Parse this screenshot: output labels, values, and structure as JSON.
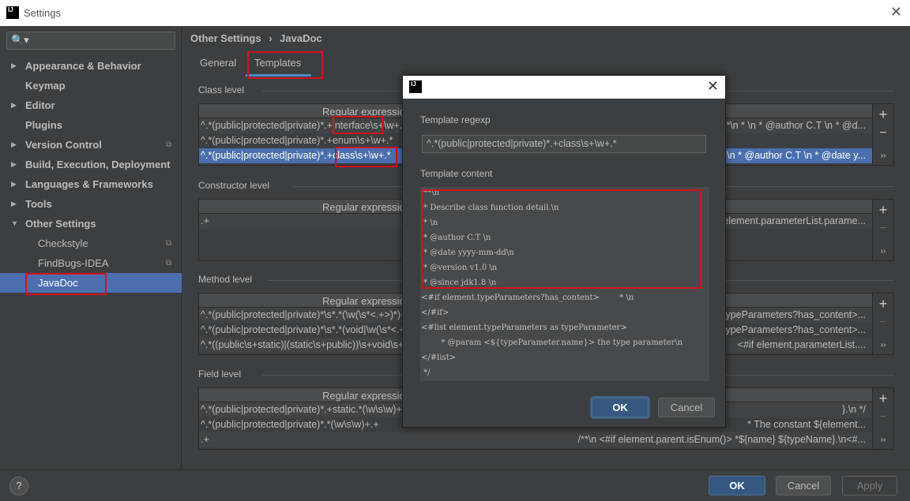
{
  "window": {
    "title": "Settings",
    "close": "✕",
    "logo": "IJ"
  },
  "sidebar": {
    "search_icon": "🔍▾",
    "items": [
      {
        "label": "Appearance & Behavior",
        "arrow": "▶",
        "level": 0
      },
      {
        "label": "Keymap",
        "arrow": "",
        "level": 0
      },
      {
        "label": "Editor",
        "arrow": "▶",
        "level": 0
      },
      {
        "label": "Plugins",
        "arrow": "",
        "level": 0
      },
      {
        "label": "Version Control",
        "arrow": "▶",
        "level": 0,
        "copy": "⧉"
      },
      {
        "label": "Build, Execution, Deployment",
        "arrow": "▶",
        "level": 0
      },
      {
        "label": "Languages & Frameworks",
        "arrow": "▶",
        "level": 0
      },
      {
        "label": "Tools",
        "arrow": "▶",
        "level": 0
      },
      {
        "label": "Other Settings",
        "arrow": "▼",
        "level": 0
      },
      {
        "label": "Checkstyle",
        "arrow": "",
        "level": 1,
        "copy": "⧉"
      },
      {
        "label": "FindBugs-IDEA",
        "arrow": "",
        "level": 1,
        "copy": "⧉"
      },
      {
        "label": "JavaDoc",
        "arrow": "",
        "level": 1,
        "selected": true
      }
    ]
  },
  "header": {
    "breadcrumb_parent": "Other Settings",
    "separator": "›",
    "breadcrumb_current": "JavaDoc"
  },
  "tabs": [
    {
      "label": "General"
    },
    {
      "label": "Templates",
      "active": true
    }
  ],
  "sections": [
    {
      "title": "Class level",
      "column": "Regular expression",
      "rows": [
        {
          "regex": "^.*(public|protected|private)*.+interface\\s+\\w+.*",
          "template": "/**\\n * \\n * @author C.T \\n * @d..."
        },
        {
          "regex": "^.*(public|protected|private)*.+enum\\s+\\w+.*",
          "template": ""
        },
        {
          "regex": "^.*(public|protected|private)*.+class\\s+\\w+.*",
          "template": "/**\\n * \\n * @author C.T \\n * @date y...",
          "selected": true
        }
      ]
    },
    {
      "title": "Constructor level",
      "column": "Regular expression",
      "rows": [
        {
          "regex": ".+",
          "template": "element.parameterList.parame..."
        }
      ]
    },
    {
      "title": "Method level",
      "column": "Regular expression",
      "rows": [
        {
          "regex": "^.*(public|protected|private)*\\s*.*(\\w(\\s*<.+>)*)+\\s+\\w+\\s*\\(.*",
          "template": "ypeParameters?has_content>..."
        },
        {
          "regex": "^.*(public|protected|private)*\\s*.*(void|\\w(\\s*<.+>)*)+\\s+\\w+\\s*\\(.*",
          "template": "ypeParameters?has_content>..."
        },
        {
          "regex": "^.*((public\\s+static)|(static\\s+public))\\s+void\\s+main.*",
          "template": "<#if element.parameterList...."
        }
      ]
    },
    {
      "title": "Field level",
      "column": "Regular expression",
      "rows": [
        {
          "regex": "^.*(public|protected|private)*.+static.*(\\w\\s\\w)+.+",
          "template": "}.\\n */"
        },
        {
          "regex": "^.*(public|protected|private)*.*(\\w\\s\\w)+.+",
          "template": "* The constant ${element..."
        },
        {
          "regex": ".+",
          "template": "/**\\n    <#if element.parent.isEnum()>        *${name} ${typeName}.\\n<#..."
        }
      ]
    }
  ],
  "table_buttons": {
    "add": "+",
    "remove": "−",
    "more": "››"
  },
  "dialog": {
    "logo": "IJ",
    "close": "✕",
    "regexp_label": "Template regexp",
    "regexp_value": "^.*(public|protected|private)*.+class\\s+\\w+.*",
    "content_label": "Template content",
    "content_lines": [
      "/**\\n",
      " * Describe class function detail.\\n",
      " * \\n",
      " * @author C.T \\n",
      " * @date yyyy-mm-dd\\n",
      " * @version v1.0 \\n",
      " * @since jdk1.8 \\n",
      "<#if element.typeParameters?has_content>        * \\n",
      "</#if>",
      "<#list element.typeParameters as typeParameter>",
      "        * @param <${typeParameter.name}> the type parameter\\n",
      "</#list>",
      " */"
    ],
    "ok": "OK",
    "cancel": "Cancel"
  },
  "footer": {
    "help": "?",
    "ok": "OK",
    "cancel": "Cancel",
    "apply": "Apply"
  },
  "colors": {
    "selection": "#4b6eaf",
    "highlight": "#d3131a",
    "background": "#3c3f41"
  }
}
